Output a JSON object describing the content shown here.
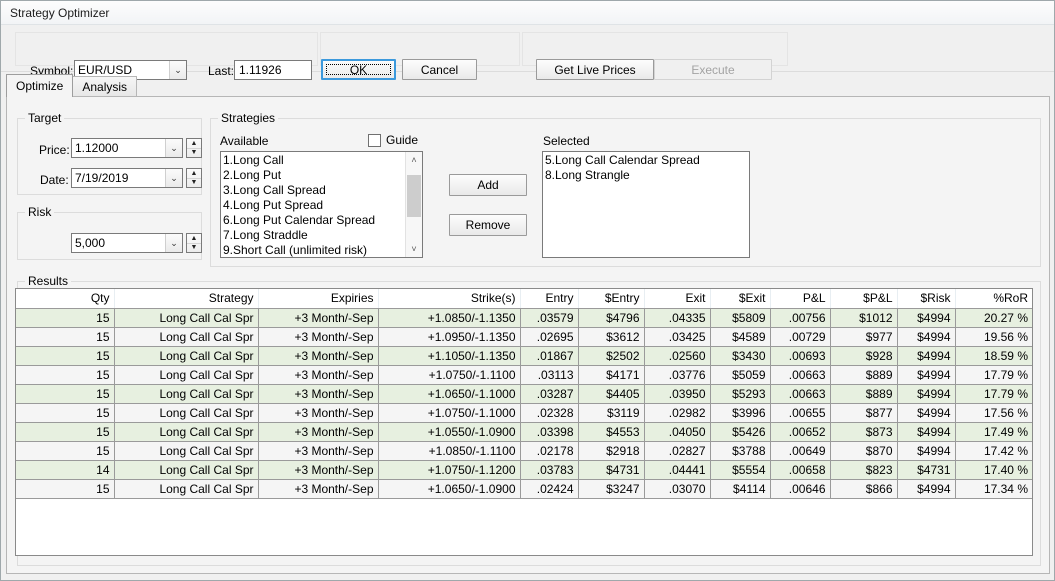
{
  "window": {
    "title": "Strategy Optimizer"
  },
  "toolbar": {
    "symbol_label": "Symbol:",
    "symbol_value": "EUR/USD",
    "last_label": "Last:",
    "last_value": "1.11926",
    "ok_label": "OK",
    "cancel_label": "Cancel",
    "get_live_prices_label": "Get Live Prices",
    "execute_label": "Execute"
  },
  "tabs": [
    {
      "label": "Optimize",
      "active": true
    },
    {
      "label": "Analysis",
      "active": false
    }
  ],
  "target": {
    "group_title": "Target",
    "price_label": "Price:",
    "price_value": "1.12000",
    "date_label": "Date:",
    "date_value": "7/19/2019"
  },
  "risk": {
    "group_title": "Risk",
    "value": "5,000"
  },
  "strategies": {
    "group_title": "Strategies",
    "available_label": "Available",
    "guide_label": "Guide",
    "guide_checked": false,
    "available_items": [
      "1.Long Call",
      "2.Long Put",
      "3.Long Call Spread",
      "4.Long Put Spread",
      "6.Long Put Calendar Spread",
      "7.Long Straddle",
      "9.Short Call (unlimited risk)"
    ],
    "add_label": "Add",
    "remove_label": "Remove",
    "selected_label": "Selected",
    "selected_items": [
      "5.Long Call Calendar Spread",
      "8.Long Strangle"
    ]
  },
  "results": {
    "group_title": "Results",
    "columns": [
      "Qty",
      "Strategy",
      "Expiries",
      "Strike(s)",
      "Entry",
      "$Entry",
      "Exit",
      "$Exit",
      "P&L",
      "$P&L",
      "$Risk",
      "%RoR"
    ],
    "rows": [
      [
        "15",
        "Long Call Cal Spr",
        "+3 Month/-Sep",
        "+1.0850/-1.1350",
        ".03579",
        "$4796",
        ".04335",
        "$5809",
        ".00756",
        "$1012",
        "$4994",
        "20.27 %"
      ],
      [
        "15",
        "Long Call Cal Spr",
        "+3 Month/-Sep",
        "+1.0950/-1.1350",
        ".02695",
        "$3612",
        ".03425",
        "$4589",
        ".00729",
        "$977",
        "$4994",
        "19.56 %"
      ],
      [
        "15",
        "Long Call Cal Spr",
        "+3 Month/-Sep",
        "+1.1050/-1.1350",
        ".01867",
        "$2502",
        ".02560",
        "$3430",
        ".00693",
        "$928",
        "$4994",
        "18.59 %"
      ],
      [
        "15",
        "Long Call Cal Spr",
        "+3 Month/-Sep",
        "+1.0750/-1.1100",
        ".03113",
        "$4171",
        ".03776",
        "$5059",
        ".00663",
        "$889",
        "$4994",
        "17.79 %"
      ],
      [
        "15",
        "Long Call Cal Spr",
        "+3 Month/-Sep",
        "+1.0650/-1.1000",
        ".03287",
        "$4405",
        ".03950",
        "$5293",
        ".00663",
        "$889",
        "$4994",
        "17.79 %"
      ],
      [
        "15",
        "Long Call Cal Spr",
        "+3 Month/-Sep",
        "+1.0750/-1.1000",
        ".02328",
        "$3119",
        ".02982",
        "$3996",
        ".00655",
        "$877",
        "$4994",
        "17.56 %"
      ],
      [
        "15",
        "Long Call Cal Spr",
        "+3 Month/-Sep",
        "+1.0550/-1.0900",
        ".03398",
        "$4553",
        ".04050",
        "$5426",
        ".00652",
        "$873",
        "$4994",
        "17.49 %"
      ],
      [
        "15",
        "Long Call Cal Spr",
        "+3 Month/-Sep",
        "+1.0850/-1.1100",
        ".02178",
        "$2918",
        ".02827",
        "$3788",
        ".00649",
        "$870",
        "$4994",
        "17.42 %"
      ],
      [
        "14",
        "Long Call Cal Spr",
        "+3 Month/-Sep",
        "+1.0750/-1.1200",
        ".03783",
        "$4731",
        ".04441",
        "$5554",
        ".00658",
        "$823",
        "$4731",
        "17.40 %"
      ],
      [
        "15",
        "Long Call Cal Spr",
        "+3 Month/-Sep",
        "+1.0650/-1.0900",
        ".02424",
        "$3247",
        ".03070",
        "$4114",
        ".00646",
        "$866",
        "$4994",
        "17.34 %"
      ]
    ]
  },
  "icons": {
    "chevron_down": "⌄",
    "spin_up": "▲",
    "spin_down": "▼",
    "scroll_up": "˄",
    "scroll_down": "˅"
  }
}
